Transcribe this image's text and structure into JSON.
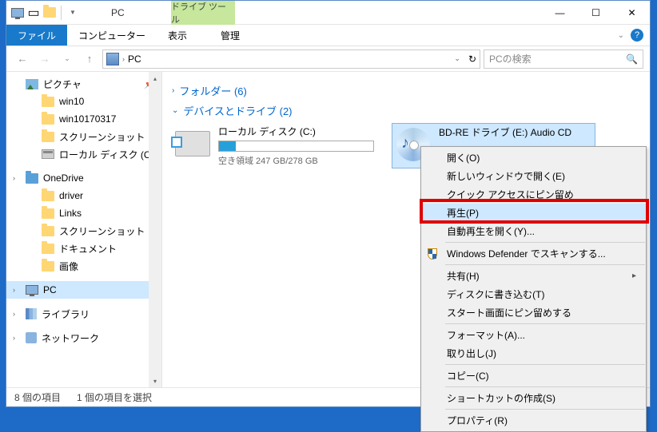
{
  "titlebar": {
    "contextTab": "ドライブ ツール",
    "title": "PC"
  },
  "ribbon": {
    "file": "ファイル",
    "computer": "コンピューター",
    "view": "表示",
    "manage": "管理"
  },
  "address": {
    "location": "PC",
    "searchPlaceholder": "PCの検索"
  },
  "nav": {
    "pictures": "ピクチャ",
    "win10": "win10",
    "win10170317": "win10170317",
    "screenshot1": "スクリーンショット",
    "localdisk": "ローカル ディスク (C:)",
    "onedrive": "OneDrive",
    "driver": "driver",
    "links": "Links",
    "screenshot2": "スクリーンショット",
    "documents": "ドキュメント",
    "images": "画像",
    "pc": "PC",
    "libraries": "ライブラリ",
    "network": "ネットワーク"
  },
  "content": {
    "folderHeader": "フォルダー (6)",
    "devicesHeader": "デバイスとドライブ (2)",
    "localDisk": {
      "name": "ローカル ディスク (C:)",
      "free": "空き領域 247 GB/278 GB"
    },
    "bdre": {
      "name": "BD-RE ドライブ (E:) Audio CD"
    }
  },
  "status": {
    "items": "8 個の項目",
    "selected": "1 個の項目を選択"
  },
  "ctx": {
    "open": "開く(O)",
    "openNewWindow": "新しいウィンドウで開く(E)",
    "pinQuickAccess": "クイック アクセスにピン留め",
    "play": "再生(P)",
    "autoplay": "自動再生を開く(Y)...",
    "defender": "Windows Defender でスキャンする...",
    "share": "共有(H)",
    "burn": "ディスクに書き込む(T)",
    "pinStart": "スタート画面にピン留めする",
    "format": "フォーマット(A)...",
    "eject": "取り出し(J)",
    "copy": "コピー(C)",
    "shortcut": "ショートカットの作成(S)",
    "properties": "プロパティ(R)"
  }
}
